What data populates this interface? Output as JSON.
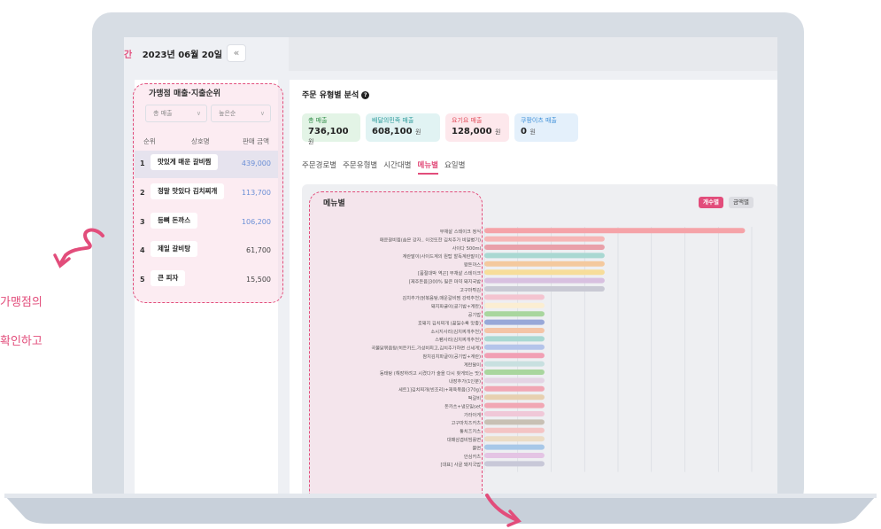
{
  "header": {
    "date_prefix": "간",
    "date": "2023년 06월 20일",
    "back_icon": "«"
  },
  "ranking": {
    "title": "가맹점 매출·지출순위",
    "filter1": "총 매출",
    "filter2": "높은순",
    "col_rank": "순위",
    "col_name": "상호명",
    "col_amount": "판매 금액",
    "rows": [
      {
        "rank": "1",
        "name": "맛있게 매운 갈비찜",
        "amount": "439,000",
        "color": "#6b8fd6"
      },
      {
        "rank": "2",
        "name": "정말 맛있다 김치찌개",
        "amount": "113,700",
        "color": "#6b8fd6"
      },
      {
        "rank": "3",
        "name": "등뼈 돈까스",
        "amount": "106,200",
        "color": "#6b8fd6"
      },
      {
        "rank": "4",
        "name": "제일 갈비탕",
        "amount": "61,700",
        "color": "#444444"
      },
      {
        "rank": "5",
        "name": "큰 피자",
        "amount": "15,500",
        "color": "#444444"
      }
    ]
  },
  "analysis": {
    "title": "주문 유형별 분석",
    "help_icon": "?",
    "cards": [
      {
        "label": "총 매출",
        "value": "736,100",
        "unit": "원",
        "bg": "#e3f4e6",
        "fg": "#2e8b46"
      },
      {
        "label": "배달의민족 매출",
        "value": "608,100",
        "unit": "원",
        "bg": "#e1f3f3",
        "fg": "#2a9a9a"
      },
      {
        "label": "요기요 매출",
        "value": "128,000",
        "unit": "원",
        "bg": "#fde8ec",
        "fg": "#e24d5b"
      },
      {
        "label": "쿠팡이츠 매출",
        "value": "0",
        "unit": "원",
        "bg": "#e4f0fb",
        "fg": "#3d8fd8"
      }
    ],
    "tabs": [
      "주문경로별",
      "주문유형별",
      "시간대별",
      "메뉴별",
      "요일별"
    ],
    "active_tab": "메뉴별"
  },
  "menu_chart": {
    "title": "메뉴별",
    "toggle_count": "개수별",
    "toggle_amount": "금액별"
  },
  "chart_data": {
    "type": "bar",
    "orientation": "horizontal",
    "title": "메뉴별",
    "categories": [
      "부채살 스테이크 정식",
      "매운갈비찜(숨은 강자.. 이것또한 김치추가 비밀병기)",
      "사이다 500ml",
      "계란말이(사이드계의 원탑 할독계란말이)",
      "왕돈까스",
      "[품절대박 역곤] 부채살 스테이크",
      "[제주돈음]300% 필큰 마약 돼지국밥",
      "고구마튀김",
      "김치추가(닭볶음탕,매운갈비찜 강력추천)",
      "돼지파글이(공기밥+계란)",
      "공기밥",
      "호돼지 김치찌개 (끓일수록 맛좋)",
      "소시지사리(김치찌개추천)",
      "스팸사리(김치찌개추천)",
      "곡물닭볶음탕(히든카드,가성비최고,김치추가하면 신세계)",
      "참치김치파글이(공기밥+계란)",
      "계란말이",
      "동태탕 (해장하려고 시켰다가 술을 다시 찾게되는 맛)",
      "내장추가(1인분)",
      "세트1]김치찌개(빈조리)+제육볶음(370g)",
      "떡갈비",
      "돈카츠+냉모밀set",
      "가라아게",
      "고구마치즈카츠",
      "통치즈카츠",
      "대패삼겹비빔롤면",
      "쫄면",
      "안심카츠",
      "[대표] 사골 돼지국밥"
    ],
    "values": [
      39,
      18,
      18,
      18,
      18,
      18,
      18,
      18,
      9,
      9,
      9,
      9,
      9,
      9,
      9,
      9,
      9,
      9,
      9,
      9,
      9,
      9,
      9,
      9,
      9,
      9,
      9,
      9,
      9
    ],
    "colors": [
      "#f5a3a8",
      "#f6b6b6",
      "#e9a0a9",
      "#a9d8d2",
      "#f4c99e",
      "#f7dd9a",
      "#d8c0e0",
      "#c9c9d4",
      "#f4c4d0",
      "#fbeed2",
      "#a9d69e",
      "#98a8d8",
      "#f4c4a6",
      "#a9d8d2",
      "#b4c4ea",
      "#f1a0b4",
      "#c8e0e0",
      "#a9d69e",
      "#e4d4e4",
      "#f1a7b4",
      "#e7d0b0",
      "#f1a7b4",
      "#f0c8d8",
      "#c8c0b4",
      "#f4c4c4",
      "#ecdcc4",
      "#a8c8e8",
      "#e4c4e4",
      "#c8c8d8"
    ],
    "xlim": [
      0,
      40
    ],
    "grid": true
  },
  "annotations": {
    "line1": "가맹점의",
    "line2": "확인하고"
  }
}
